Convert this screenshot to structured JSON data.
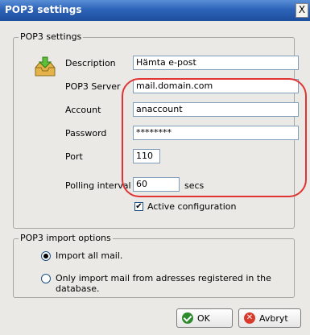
{
  "window": {
    "title": "POP3 settings",
    "close_glyph": "X"
  },
  "pop3_settings": {
    "group_title": "POP3 settings",
    "icon": "inbox-download-icon",
    "description": {
      "label": "Description",
      "value": "Hämta e-post"
    },
    "server": {
      "label": "POP3 Server",
      "value": "mail.domain.com"
    },
    "account": {
      "label": "Account",
      "value": "anaccount"
    },
    "password": {
      "label": "Password",
      "value": "********"
    },
    "port": {
      "label": "Port",
      "value": "110"
    },
    "polling": {
      "label": "Polling interval",
      "value": "60",
      "unit": "secs"
    },
    "active": {
      "label": "Active configuration",
      "checked": true
    }
  },
  "import_options": {
    "group_title": "POP3 import options",
    "options": [
      {
        "label": "Import all mail.",
        "selected": true
      },
      {
        "label": "Only import mail from adresses registered in the database.",
        "selected": false
      }
    ]
  },
  "buttons": {
    "ok": "OK",
    "cancel": "Avbryt"
  },
  "colors": {
    "highlight": "#e03434",
    "titlebar": "#2d63b8"
  }
}
